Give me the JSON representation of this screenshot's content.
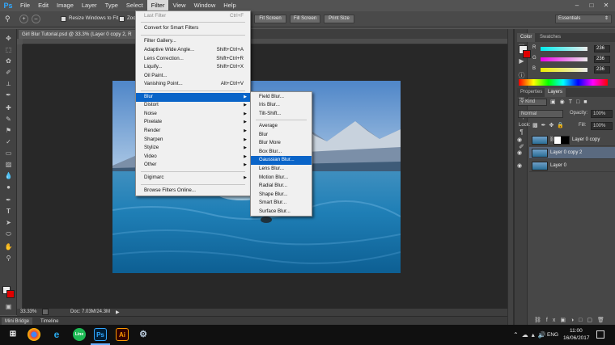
{
  "menubar": {
    "logo": "Ps",
    "items": [
      "File",
      "Edit",
      "Image",
      "Layer",
      "Type",
      "Select",
      "Filter",
      "View",
      "Window",
      "Help"
    ],
    "active_item": "Filter"
  },
  "options_bar": {
    "resize_windows_label": "Resize Windows to Fit",
    "zoom_all_label": "Zoo",
    "screen_buttons": [
      "Fit Screen",
      "Fill Screen",
      "Print Size"
    ],
    "workspace": "Essentials"
  },
  "document": {
    "tab_title": "Girl Blur Tutorial.psd @ 33.3% (Layer 0 copy 2, R",
    "zoom": "33.33%",
    "doc_info": "Doc: 7.03M/24.3M"
  },
  "bottom_tabs": [
    "Mini Bridge",
    "Timeline"
  ],
  "filter_menu": {
    "items": [
      {
        "label": "Last Filter",
        "shortcut": "Ctrl+F",
        "disabled": true
      },
      {
        "label": "Convert for Smart Filters",
        "shortcut": ""
      },
      {
        "label": "Filter Gallery...",
        "shortcut": ""
      },
      {
        "label": "Adaptive Wide Angle...",
        "shortcut": "Shift+Ctrl+A"
      },
      {
        "label": "Lens Correction...",
        "shortcut": "Shift+Ctrl+R"
      },
      {
        "label": "Liquify...",
        "shortcut": "Shift+Ctrl+X"
      },
      {
        "label": "Oil Paint...",
        "shortcut": ""
      },
      {
        "label": "Vanishing Point...",
        "shortcut": "Alt+Ctrl+V"
      },
      {
        "label": "Blur",
        "submenu": true
      },
      {
        "label": "Distort",
        "submenu": true
      },
      {
        "label": "Noise",
        "submenu": true
      },
      {
        "label": "Pixelate",
        "submenu": true
      },
      {
        "label": "Render",
        "submenu": true
      },
      {
        "label": "Sharpen",
        "submenu": true
      },
      {
        "label": "Stylize",
        "submenu": true
      },
      {
        "label": "Video",
        "submenu": true
      },
      {
        "label": "Other",
        "submenu": true
      },
      {
        "label": "Digimarc",
        "submenu": true
      },
      {
        "label": "Browse Filters Online...",
        "shortcut": ""
      }
    ]
  },
  "blur_submenu": {
    "items": [
      "Field Blur...",
      "Iris Blur...",
      "Tilt-Shift...",
      "Average",
      "Blur",
      "Blur More",
      "Box Blur...",
      "Gaussian Blur...",
      "Lens Blur...",
      "Motion Blur...",
      "Radial Blur...",
      "Shape Blur...",
      "Smart Blur...",
      "Surface Blur..."
    ],
    "highlighted": "Gaussian Blur..."
  },
  "color_panel": {
    "tabs": [
      "Color",
      "Swatches"
    ],
    "r_label": "R",
    "g_label": "G",
    "b_label": "B",
    "r": "236",
    "g": "236",
    "b": "236",
    "fg_color": "#ececec",
    "bg_color": "#e00000"
  },
  "layers_panel": {
    "tabs": [
      "Properties",
      "Layers"
    ],
    "filter_kind": "Kind",
    "blend_mode": "Normal",
    "opacity_label": "Opacity:",
    "opacity": "100%",
    "lock_label": "Lock:",
    "fill_label": "Fill:",
    "fill": "100%",
    "layers": [
      {
        "name": "Layer 0 copy",
        "has_mask": true,
        "selected": false
      },
      {
        "name": "Layer 0 copy 2",
        "has_mask": false,
        "selected": true
      },
      {
        "name": "Layer 0",
        "has_mask": false,
        "selected": false
      }
    ]
  },
  "taskbar": {
    "language": "ENG",
    "time": "11:00",
    "date": "16/06/2017"
  }
}
